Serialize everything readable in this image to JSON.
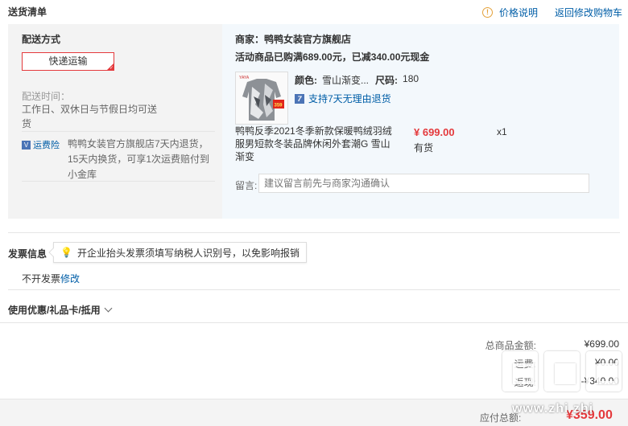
{
  "header": {
    "title": "送货清单",
    "price_info_link": "价格说明",
    "back_link": "返回修改购物车"
  },
  "shipping": {
    "label": "配送方式",
    "method_button": "快递运输",
    "time_label": "配送时间：",
    "time_value": "工作日、双休日与节假日均可送货",
    "insurance_badge": "运费险",
    "insurance_text": "鸭鸭女装官方旗舰店7天内退货，15天内换货，可享1次运费赔付到小金库"
  },
  "order": {
    "merchant": "商家：鸭鸭女装官方旗舰店",
    "promo": "活动商品已购满689.00元，已减340.00元现金",
    "product_image_text": "YAYA",
    "product_badge": "359",
    "color_label": "颜色:",
    "color_value": "雪山渐变...",
    "size_label": "尺码:",
    "size_value": "180",
    "return_policy": "支持7天无理由退货",
    "product_name": "鸭鸭反季2021冬季新款保暖鸭绒羽绒服男短款冬装品牌休闲外套潮G 雪山渐变",
    "price": "¥ 699.00",
    "stock": "有货",
    "quantity": "x1",
    "note_label": "留言:",
    "note_placeholder": "建议留言前先与商家沟通确认"
  },
  "invoice": {
    "label": "发票信息",
    "tip": "开企业抬头发票须填写纳税人识别号，以免影响报销",
    "status": "不开发票",
    "edit_link": "修改"
  },
  "coupons": {
    "toggle_label": "使用优惠/礼品卡/抵用"
  },
  "totals": {
    "goods_label": "总商品金额:",
    "goods_value": "¥699.00",
    "shipping_label": "运费:",
    "shipping_value": "¥0.00",
    "discount_label": "返现:",
    "discount_value": "-¥340.00",
    "due_label": "应付总额:",
    "due_value": "¥359.00"
  },
  "watermark": {
    "text": "www.zhi zhi"
  },
  "colors": {
    "accent_red": "#e4393c",
    "link_blue": "#005ea7"
  }
}
